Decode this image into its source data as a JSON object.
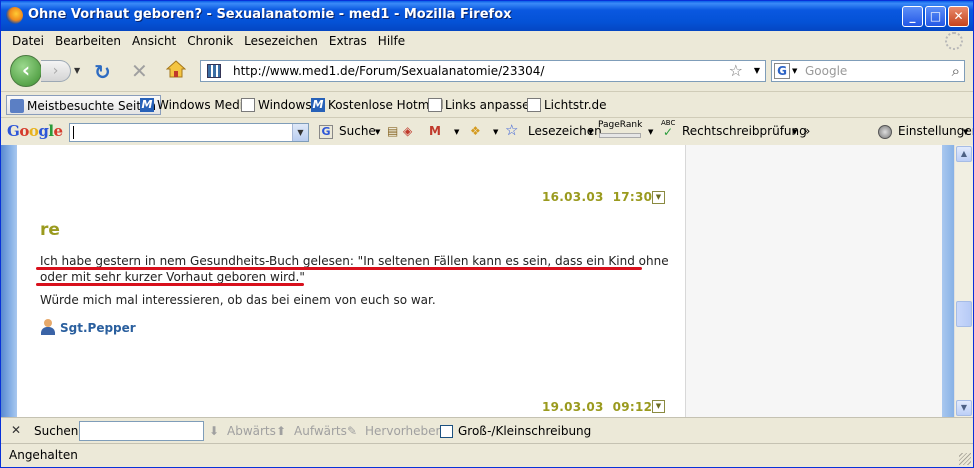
{
  "window": {
    "title": "Ohne Vorhaut geboren? - Sexualanatomie - med1 - Mozilla Firefox",
    "minimize": "_",
    "maximize": "□",
    "close": "✕"
  },
  "menu": [
    "Datei",
    "Bearbeiten",
    "Ansicht",
    "Chronik",
    "Lesezeichen",
    "Extras",
    "Hilfe"
  ],
  "nav": {
    "url": "http://www.med1.de/Forum/Sexualanatomie/23304/",
    "search_placeholder": "Google",
    "search_engine_letter": "G"
  },
  "bookmarks": [
    {
      "label": "Meistbesuchte Seiten",
      "icon": "bookmark-folder-icon"
    },
    {
      "label": "Windows Media",
      "icon": "msn-icon"
    },
    {
      "label": "Windows",
      "icon": "page-icon"
    },
    {
      "label": "Kostenlose Hotmail",
      "icon": "msn-icon"
    },
    {
      "label": "Links anpassen",
      "icon": "page-icon"
    },
    {
      "label": "Lichtstr.de",
      "icon": "page-icon"
    }
  ],
  "google_toolbar": {
    "logo": [
      "G",
      "o",
      "o",
      "g",
      "l",
      "e"
    ],
    "search_value": "",
    "suche": "Suche",
    "lesezeichen": "Lesezeichen",
    "pagerank": "PageRank",
    "abc": "ABC",
    "rechtschreib": "Rechtschreibprüfung",
    "more": "»",
    "einstellungen": "Einstellungen"
  },
  "posts": {
    "first_date": "16.03.03  17:30",
    "title": "re",
    "lines": [
      "Ich habe gestern in nem Gesundheits-Buch gelesen: \"In seltenen Fällen kann es sein, dass ein Kind ohne",
      "oder mit sehr kurzer Vorhaut geboren wird.\"",
      "Würde mich mal interessieren, ob das bei einem von euch so war."
    ],
    "author": "Sgt.Pepper",
    "second_date": "19.03.03  09:12"
  },
  "findbar": {
    "label": "Suchen:",
    "value": "",
    "down": "Abwärts",
    "up": "Aufwärts",
    "highlight": "Hervorheben",
    "matchcase": "Groß-/Kleinschreibung"
  },
  "status": "Angehalten",
  "colors": {
    "titlebar": "#0452d6",
    "date_olive": "#9a9a1e",
    "author_blue": "#2a5f9e",
    "underline_red": "#d8101c"
  }
}
